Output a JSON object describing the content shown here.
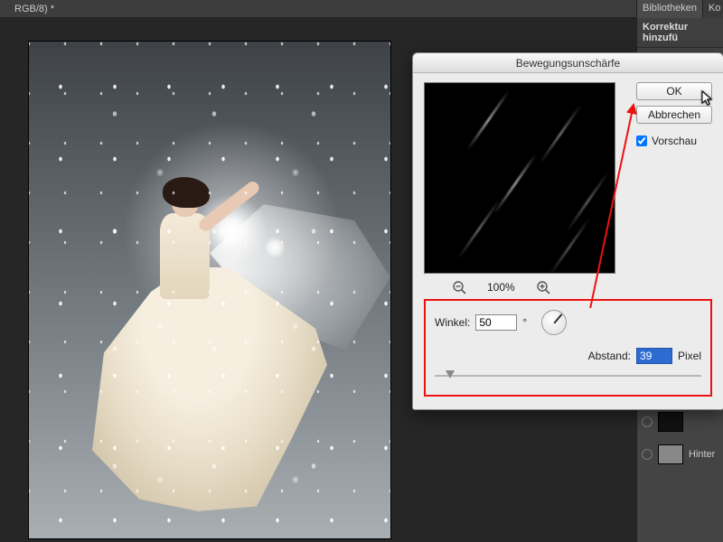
{
  "doc": {
    "tab": "RGB/8) *"
  },
  "rail": {
    "tab1": "Bibliotheken",
    "tab2": "Ko",
    "header": "Korrektur hinzufü",
    "layer_label": "Hinter"
  },
  "dialog": {
    "title": "Bewegungsunschärfe",
    "zoom": "100%",
    "angle_label": "Winkel:",
    "angle_value": "50",
    "angle_unit": "°",
    "distance_label": "Abstand:",
    "distance_value": "39",
    "distance_unit": "Pixel",
    "ok": "OK",
    "cancel": "Abbrechen",
    "preview_label": "Vorschau",
    "preview_checked": true
  }
}
